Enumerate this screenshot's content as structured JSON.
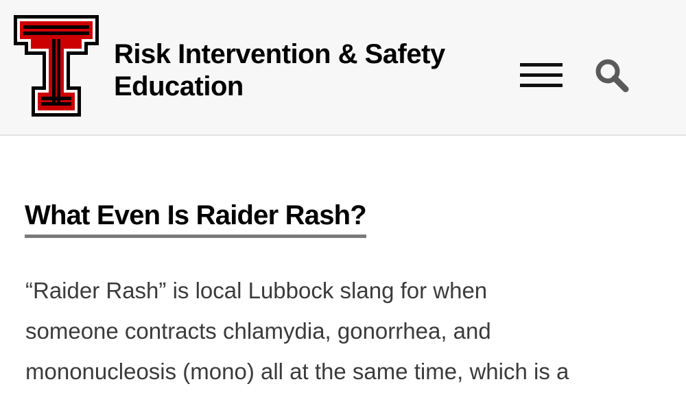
{
  "header": {
    "logo_icon": "double-t-logo-icon",
    "title_line1": "Risk Intervention & Safety",
    "title_line2": "Education",
    "menu_icon": "hamburger-menu-icon",
    "search_icon": "search-icon"
  },
  "article": {
    "heading": "What Even Is Raider Rash?",
    "paragraph_lines": [
      "“Raider Rash” is local Lubbock slang for when",
      "someone contracts chlamydia, gonorrhea, and",
      "mononucleosis (mono) all at the same time, which is a"
    ]
  },
  "colors": {
    "logo_red": "#cc0000",
    "logo_black": "#000000",
    "header_bg": "#f7f7f7",
    "heading_underline": "#7a7a7a",
    "body_text": "#3b3b3b"
  }
}
